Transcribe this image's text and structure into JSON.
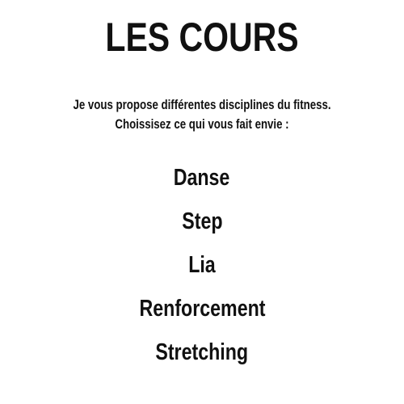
{
  "title": "LES COURS",
  "intro": {
    "line1": "Je vous propose différentes disciplines du fitness.",
    "line2": "Choissisez ce qui vous fait envie :"
  },
  "courses": [
    {
      "label": "Danse"
    },
    {
      "label": "Step"
    },
    {
      "label": "Lia"
    },
    {
      "label": "Renforcement"
    },
    {
      "label": "Stretching"
    }
  ]
}
